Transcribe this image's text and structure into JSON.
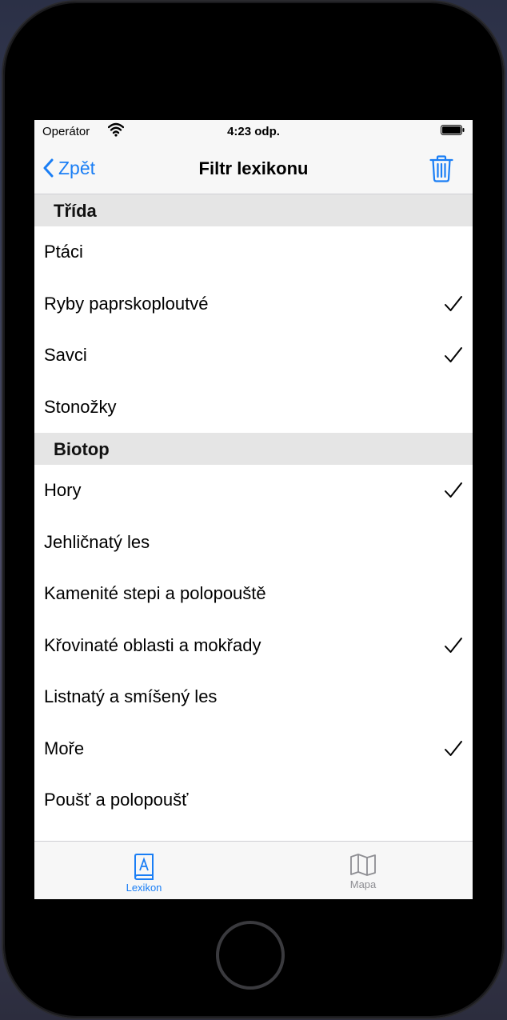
{
  "status_bar": {
    "carrier": "Operátor",
    "time": "4:23 odp."
  },
  "nav": {
    "back_label": "Zpět",
    "title": "Filtr lexikonu"
  },
  "sections": [
    {
      "header": "Třída",
      "items": [
        {
          "label": "Ptáci",
          "checked": false
        },
        {
          "label": "Ryby paprskoploutvé",
          "checked": true
        },
        {
          "label": "Savci",
          "checked": true
        },
        {
          "label": "Stonožky",
          "checked": false
        }
      ]
    },
    {
      "header": "Biotop",
      "items": [
        {
          "label": "Hory",
          "checked": true
        },
        {
          "label": "Jehličnatý les",
          "checked": false
        },
        {
          "label": "Kamenité stepi a polopouště",
          "checked": false
        },
        {
          "label": "Křovinaté oblasti a mokřady",
          "checked": true
        },
        {
          "label": "Listnatý a smíšený les",
          "checked": false
        },
        {
          "label": "Moře",
          "checked": true
        },
        {
          "label": "Poušť a polopoušť",
          "checked": false
        }
      ]
    }
  ],
  "tabs": [
    {
      "label": "Lexikon",
      "icon": "book-icon",
      "active": true
    },
    {
      "label": "Mapa",
      "icon": "map-icon",
      "active": false
    }
  ],
  "colors": {
    "accent": "#1a7ef5",
    "inactive": "#8e8e93"
  }
}
